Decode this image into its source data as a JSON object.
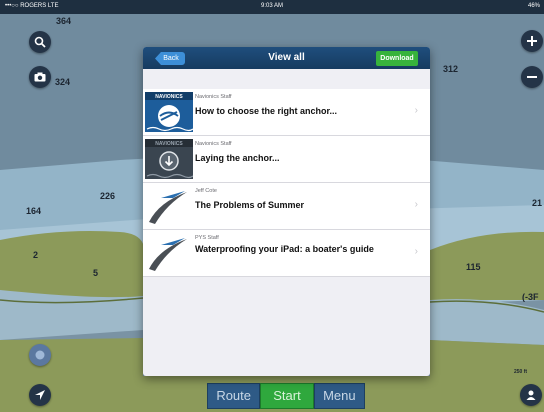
{
  "status_bar": {
    "carrier": "•••○○ ROGERS  LTE",
    "time": "9:03 AM",
    "battery": "46%"
  },
  "map": {
    "depth_labels": [
      "364",
      "324",
      "312",
      "226",
      "164",
      "2",
      "5",
      "115",
      "21",
      "(-3F"
    ],
    "colors": {
      "deep": "#6f8a9c",
      "mid": "#8fb2c9",
      "shallow": "#aac7d8",
      "land": "#8c9a5a",
      "shore": "#6b7f41"
    },
    "scale_label": "250 ft"
  },
  "bottom_bar": {
    "route_label": "Route",
    "start_label": "Start",
    "menu_label": "Menu"
  },
  "dialog": {
    "title": "View all",
    "back_label": "Back",
    "download_label": "Download",
    "items": [
      {
        "author": "Navionics Staff",
        "title": "How to choose the right anchor...",
        "thumb": "navionics-logo"
      },
      {
        "author": "Navionics Staff",
        "title": "Laying the anchor...",
        "thumb": "navionics-download"
      },
      {
        "author": "Jeff Cote",
        "title": "The Problems of Summer",
        "thumb": "pys-swoosh"
      },
      {
        "author": "PYS Staff",
        "title": "Waterproofing your iPad: a boater's guide",
        "thumb": "pys-swoosh"
      }
    ]
  }
}
